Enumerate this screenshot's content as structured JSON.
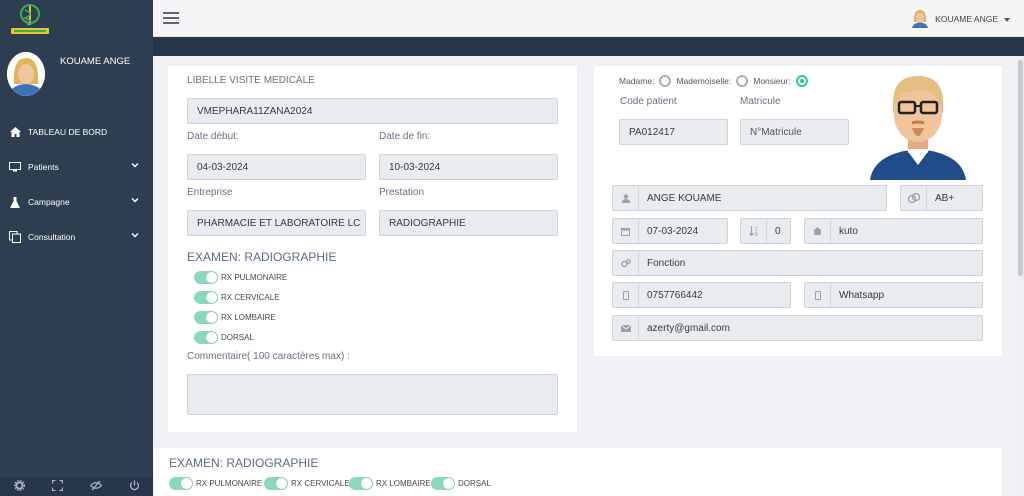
{
  "sidebar": {
    "logo_icon": "caduceus-logo",
    "user_name": "KOUAME ANGE",
    "items": [
      {
        "label": "TABLEAU DE BORD",
        "icon": "home-icon"
      },
      {
        "label": "Patients",
        "icon": "monitor-icon"
      },
      {
        "label": "Campagne",
        "icon": "flask-icon"
      },
      {
        "label": "Consultation",
        "icon": "copy-icon"
      }
    ],
    "footer_icons": [
      "gear-icon",
      "expand-icon",
      "eye-slash-icon",
      "power-icon"
    ]
  },
  "topbar": {
    "user_name": "KOUAME ANGE"
  },
  "visit": {
    "libelle_label": "LIBELLE VISITE MEDICALE",
    "libelle_value": "VMEPHARA11ZANA2024",
    "date_debut_label": "Date début:",
    "date_debut_value": "04-03-2024",
    "date_fin_label": "Date de fin:",
    "date_fin_value": "10-03-2024",
    "entreprise_label": "Entreprise",
    "entreprise_value": "PHARMACIE ET LABORATOIRE LC",
    "prestation_label": "Prestation",
    "prestation_value": "RADIOGRAPHIE",
    "examen_title": "EXAMEN: RADIOGRAPHIE",
    "exams": [
      "RX PULMONAIRE",
      "RX CERVICALE",
      "RX LOMBAIRE",
      "DORSAL"
    ],
    "commentaire_label": "Commentaire( 100 caractères max) :",
    "commentaire_value": ""
  },
  "patient": {
    "civilite": [
      {
        "label": "Madame:",
        "checked": false
      },
      {
        "label": "Mademoiselle:",
        "checked": false
      },
      {
        "label": "Monsieur:",
        "checked": true
      }
    ],
    "code_label": "Code patient",
    "code_value": "PA012417",
    "matricule_label": "Matricule",
    "matricule_placeholder": "N°Matricule",
    "name": "ANGE KOUAME",
    "blood_group": "AB+",
    "birth_date": "07-03-2024",
    "children": "0",
    "city": "kuto",
    "fonction_placeholder": "Fonction",
    "phone": "0757766442",
    "whatsapp_placeholder": "Whatsapp",
    "email": "azerty@gmail.com"
  },
  "bottom": {
    "examen_title": "EXAMEN: RADIOGRAPHIE",
    "exams": [
      "RX PULMONAIRE",
      "RX CERVICALE",
      "RX LOMBAIRE",
      "DORSAL"
    ]
  },
  "colors": {
    "sidebar": "#2d3e50",
    "accent": "#27c9a6",
    "toggle": "#8ad8bf"
  }
}
